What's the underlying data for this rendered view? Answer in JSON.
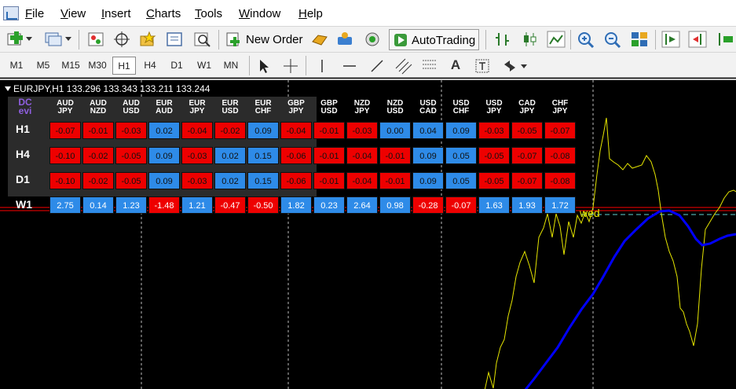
{
  "menu": [
    "File",
    "View",
    "Insert",
    "Charts",
    "Tools",
    "Window",
    "Help"
  ],
  "toolbar": {
    "new_order_label": "New Order",
    "autotrading_label": "AutoTrading"
  },
  "timeframes": [
    "M1",
    "M5",
    "M15",
    "M30",
    "H1",
    "H4",
    "D1",
    "W1",
    "MN"
  ],
  "active_timeframe": "H1",
  "chart": {
    "title": "EURJPY,H1  133.296 133.343 133.211 133.244",
    "logo_line1": "DC",
    "logo_line2": "evi",
    "marker_label": "wed",
    "colors": {
      "price": "#e6e600",
      "ma": "#0000ff",
      "level": "#ff0000"
    }
  },
  "indicator": {
    "pairs": [
      {
        "top": "AUD",
        "bottom": "JPY"
      },
      {
        "top": "AUD",
        "bottom": "NZD"
      },
      {
        "top": "AUD",
        "bottom": "USD"
      },
      {
        "top": "EUR",
        "bottom": "AUD"
      },
      {
        "top": "EUR",
        "bottom": "JPY"
      },
      {
        "top": "EUR",
        "bottom": "USD"
      },
      {
        "top": "EUR",
        "bottom": "CHF"
      },
      {
        "top": "GBP",
        "bottom": "JPY"
      },
      {
        "top": "GBP",
        "bottom": "USD"
      },
      {
        "top": "NZD",
        "bottom": "JPY"
      },
      {
        "top": "NZD",
        "bottom": "USD"
      },
      {
        "top": "USD",
        "bottom": "CAD"
      },
      {
        "top": "USD",
        "bottom": "CHF"
      },
      {
        "top": "USD",
        "bottom": "JPY"
      },
      {
        "top": "CAD",
        "bottom": "JPY"
      },
      {
        "top": "CHF",
        "bottom": "JPY"
      }
    ],
    "rows": [
      {
        "label": "H1",
        "values": [
          "-0.07",
          "-0.01",
          "-0.03",
          "0.02",
          "-0.04",
          "-0.02",
          "0.09",
          "-0.04",
          "-0.01",
          "-0.03",
          "0.00",
          "0.04",
          "0.09",
          "-0.03",
          "-0.05",
          "-0.07"
        ]
      },
      {
        "label": "H4",
        "values": [
          "-0.10",
          "-0.02",
          "-0.05",
          "0.09",
          "-0.03",
          "0.02",
          "0.15",
          "-0.06",
          "-0.01",
          "-0.04",
          "-0.01",
          "0.09",
          "0.05",
          "-0.05",
          "-0.07",
          "-0.08"
        ]
      },
      {
        "label": "D1",
        "values": [
          "-0.10",
          "-0.02",
          "-0.05",
          "0.09",
          "-0.03",
          "0.02",
          "0.15",
          "-0.06",
          "-0.01",
          "-0.04",
          "-0.01",
          "0.09",
          "0.05",
          "-0.05",
          "-0.07",
          "-0.08"
        ]
      },
      {
        "label": "W1",
        "values": [
          "2.75",
          "0.14",
          "1.23",
          "-1.48",
          "1.21",
          "-0.47",
          "-0.50",
          "1.82",
          "0.23",
          "2.64",
          "0.98",
          "-0.28",
          "-0.07",
          "1.63",
          "1.93",
          "1.72"
        ]
      }
    ]
  }
}
